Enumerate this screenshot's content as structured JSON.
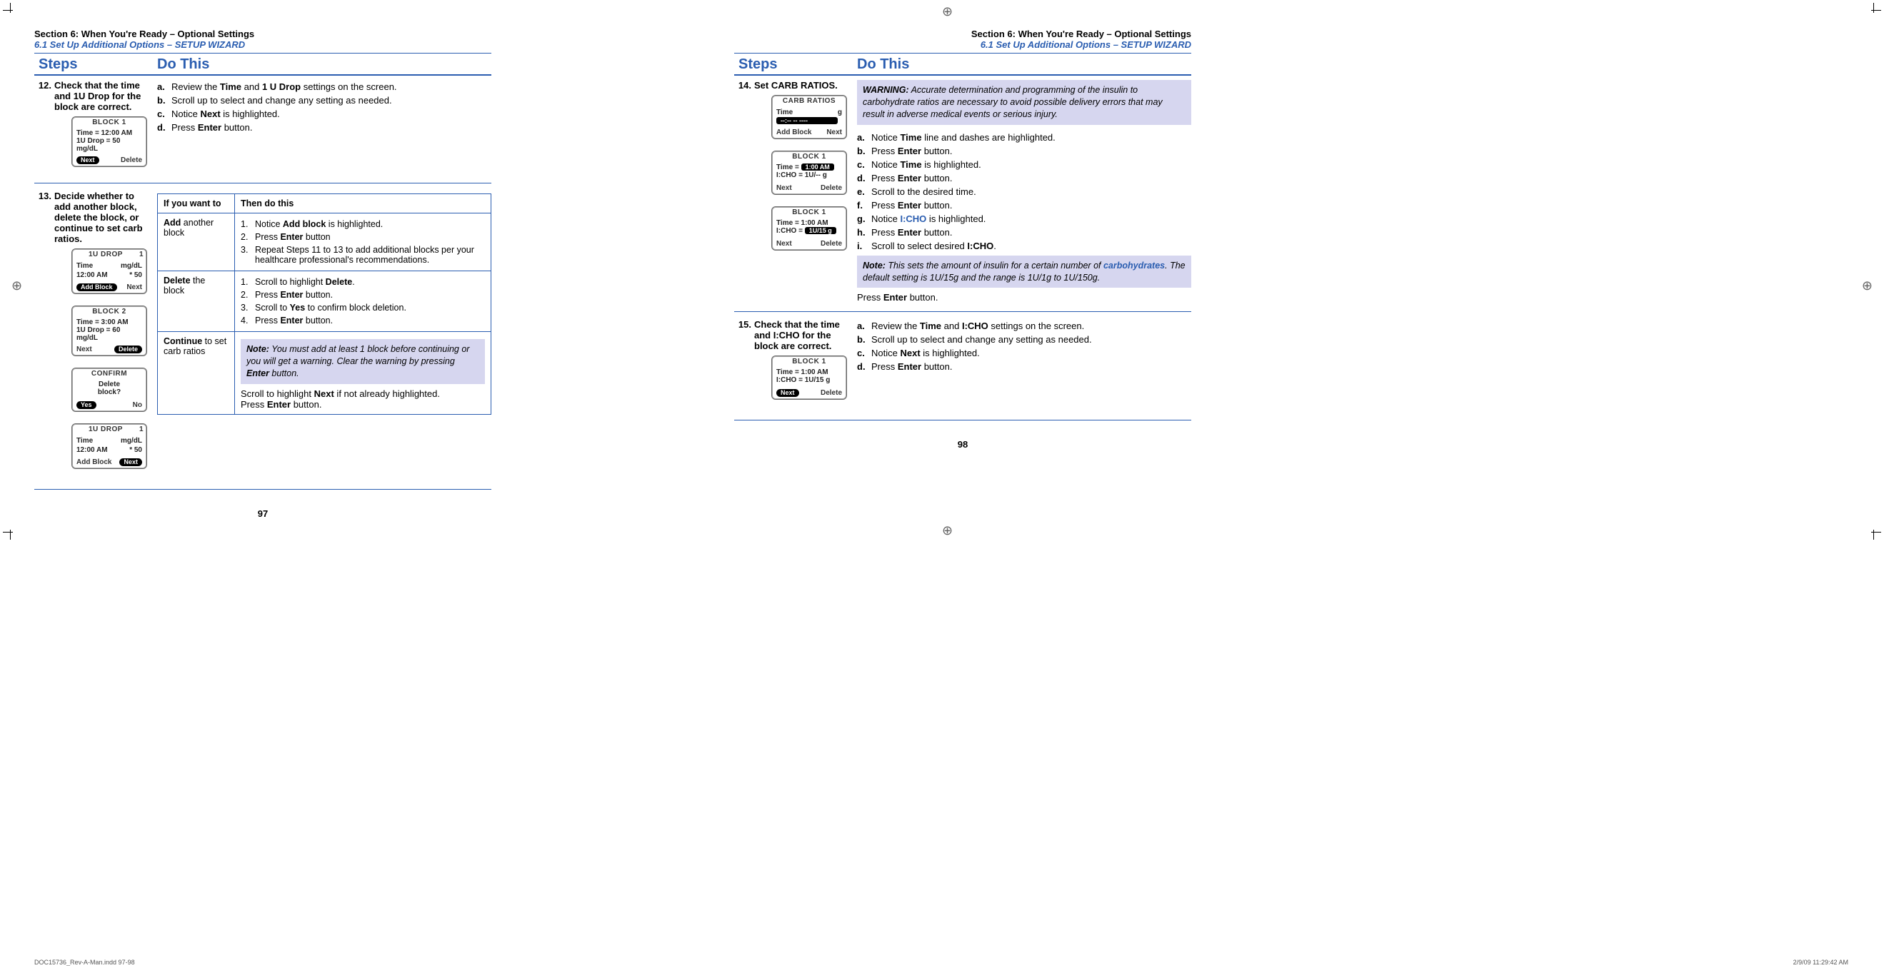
{
  "header": {
    "section_title": "Section 6: When You're Ready – Optional Settings",
    "section_sub": "6.1 Set Up Additional Options – SETUP WIZARD"
  },
  "col_headers": {
    "steps": "Steps",
    "do_this": "Do This"
  },
  "p97": {
    "num": "97",
    "step12": {
      "num": "12.",
      "title": "Check that the time and 1U Drop for the block are correct.",
      "a": "Review the ",
      "a_b1": "Time",
      "a_mid": " and ",
      "a_b2": "1 U Drop",
      "a_end": " settings on the screen.",
      "b": "Scroll up to select and change any setting as needed.",
      "c_pre": "Notice ",
      "c_b": "Next",
      "c_end": " is highlighted.",
      "d_pre": "Press ",
      "d_b": "Enter",
      "d_end": " button.",
      "dev": {
        "title": "BLOCK 1",
        "l1": "Time = 12:00 AM",
        "l2": "1U Drop = 50 mg/dL",
        "left": "Next",
        "right": "Delete"
      }
    },
    "step13": {
      "num": "13.",
      "title": "Decide whether to add another block, delete the block, or continue to set carb ratios.",
      "th1": "If you want to",
      "th2": "Then do this",
      "r1_if_pre": "Add",
      "r1_if_end": " another block",
      "r1_1_pre": "Notice ",
      "r1_1_b": "Add block",
      "r1_1_end": " is highlighted.",
      "r1_2_pre": "Press ",
      "r1_2_b": "Enter",
      "r1_2_end": " button",
      "r1_3": "Repeat Steps 11 to 13 to add additional blocks per your healthcare professional's recommendations.",
      "r2_if_pre": "Delete",
      "r2_if_end": " the block",
      "r2_1_pre": "Scroll to highlight ",
      "r2_1_b": "Delete",
      "r2_1_end": ".",
      "r2_2_pre": "Press ",
      "r2_2_b": "Enter",
      "r2_2_end": " button.",
      "r2_3_pre": "Scroll to ",
      "r2_3_b": "Yes",
      "r2_3_end": " to confirm block deletion.",
      "r2_4_pre": "Press ",
      "r2_4_b": "Enter",
      "r2_4_end": " button.",
      "r3_if_pre": "Continue",
      "r3_if_end": " to set carb ratios",
      "r3_note_lbl": "Note:",
      "r3_note_txt": " You must add at least 1 block before continuing or you will get a warning. Clear the warning by pressing ",
      "r3_note_b": "Enter",
      "r3_note_end": " button.",
      "r3_after1_pre": "Scroll to highlight ",
      "r3_after1_b": "Next",
      "r3_after1_end": " if not already highlighted.",
      "r3_after2_pre": "Press ",
      "r3_after2_b": "Enter",
      "r3_after2_end": " button.",
      "devA": {
        "title": "1U DROP",
        "badge": "1",
        "h1": "Time",
        "h2": "mg/dL",
        "v1": "12:00 AM",
        "v2": "* 50",
        "left": "Add Block",
        "right": "Next"
      },
      "devB": {
        "title": "BLOCK 2",
        "l1": "Time = 3:00 AM",
        "l2": "1U Drop = 60 mg/dL",
        "left": "Next",
        "right": "Delete"
      },
      "devC": {
        "title": "CONFIRM",
        "l1": "Delete",
        "l2": "block?",
        "left": "Yes",
        "right": "No"
      },
      "devD": {
        "title": "1U DROP",
        "badge": "1",
        "h1": "Time",
        "h2": "mg/dL",
        "v1": "12:00 AM",
        "v2": "* 50",
        "left": "Add Block",
        "right": "Next"
      }
    }
  },
  "p98": {
    "num": "98",
    "step14": {
      "num": "14.",
      "title": "Set CARB RATIOS.",
      "warn_lbl": "WARNING:",
      "warn_txt": " Accurate determination and programming of the insulin to carbohydrate ratios are necessary to avoid possible delivery errors that may result in adverse medical events or serious injury.",
      "a_pre": "Notice ",
      "a_b": "Time",
      "a_end": " line and dashes are highlighted.",
      "b_pre": "Press ",
      "b_b": "Enter",
      "b_end": " button.",
      "c_pre": "Notice ",
      "c_b": "Time",
      "c_end": " is highlighted.",
      "d_pre": "Press ",
      "d_b": "Enter",
      "d_end": " button.",
      "e": "Scroll to the desired time.",
      "f_pre": "Press ",
      "f_b": "Enter",
      "f_end": " button.",
      "g_pre": "Notice ",
      "g_b": "I:CHO",
      "g_end": " is highlighted.",
      "h_pre": "Press ",
      "h_b": "Enter",
      "h_end": " button.",
      "i_pre": "Scroll to select desired ",
      "i_b": "I:CHO",
      "i_end": ".",
      "note_lbl": "Note:",
      "note_txt": " This sets the amount of insulin for a certain number of ",
      "note_link": "carbohydrates",
      "note_end": ". The default setting is 1U/15g and the range is 1U/1g to 1U/150g.",
      "after_pre": "Press ",
      "after_b": "Enter",
      "after_end": " button.",
      "devA": {
        "title": "CARB RATIOS",
        "h1": "Time",
        "h2": "g",
        "hl": "--:-- --        ----",
        "left": "Add Block",
        "right": "Next"
      },
      "devB": {
        "title": "BLOCK 1",
        "l1_pre": "Time =",
        "l1_hl": "1:00  AM",
        "l2": "I:CHO = 1U/-- g",
        "left": "Next",
        "right": "Delete"
      },
      "devC": {
        "title": "BLOCK 1",
        "l1": "Time = 1:00 AM",
        "l2_pre": "I:CHO =",
        "l2_hl": "1U/15  g",
        "left": "Next",
        "right": "Delete"
      }
    },
    "step15": {
      "num": "15.",
      "title": "Check that the time and I:CHO for the block are correct.",
      "a_pre": "Review the ",
      "a_b1": "Time",
      "a_mid": " and ",
      "a_b2": "I:CHO",
      "a_end": " settings on the screen.",
      "b": "Scroll up to select and change any setting as needed.",
      "c_pre": "Notice ",
      "c_b": "Next",
      "c_end": " is highlighted.",
      "d_pre": "Press ",
      "d_b": "Enter",
      "d_end": " button.",
      "dev": {
        "title": "BLOCK 1",
        "l1": "Time = 1:00 AM",
        "l2": "I:CHO = 1U/15 g",
        "left": "Next",
        "right": "Delete"
      }
    }
  },
  "footer": {
    "left": "DOC15736_Rev-A-Man.indd   97-98",
    "right": "2/9/09   11:29:42 AM"
  }
}
